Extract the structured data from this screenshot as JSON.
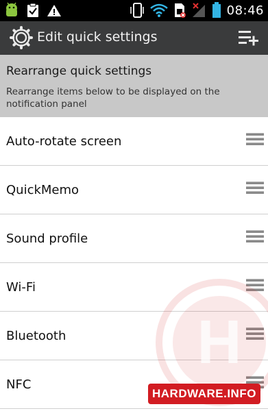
{
  "status_bar": {
    "time": "08:46",
    "left_icons": [
      "android-debug-icon",
      "clipboard-check-icon",
      "warning-icon"
    ],
    "right_icons": [
      "phone-vibrate-icon",
      "wifi-icon",
      "no-sim-icon",
      "signal-icon",
      "battery-icon"
    ]
  },
  "action_bar": {
    "title": "Edit quick settings",
    "left_icon": "gear-icon",
    "right_icon": "add-list-icon"
  },
  "header": {
    "title": "Rearrange quick settings",
    "subtitle": "Rearrange items below to be displayed on the notification panel"
  },
  "items": [
    {
      "label": "Auto-rotate screen"
    },
    {
      "label": "QuickMemo"
    },
    {
      "label": "Sound profile"
    },
    {
      "label": "Wi-Fi"
    },
    {
      "label": "Bluetooth"
    },
    {
      "label": "NFC"
    }
  ],
  "watermark": {
    "text": "HARDWARE.INFO",
    "letter": "H",
    "color": "#d21c22"
  },
  "colors": {
    "action_bar_bg": "#3a3b3c",
    "header_bg": "#c8c8c8",
    "divider": "#cfcfcf"
  }
}
